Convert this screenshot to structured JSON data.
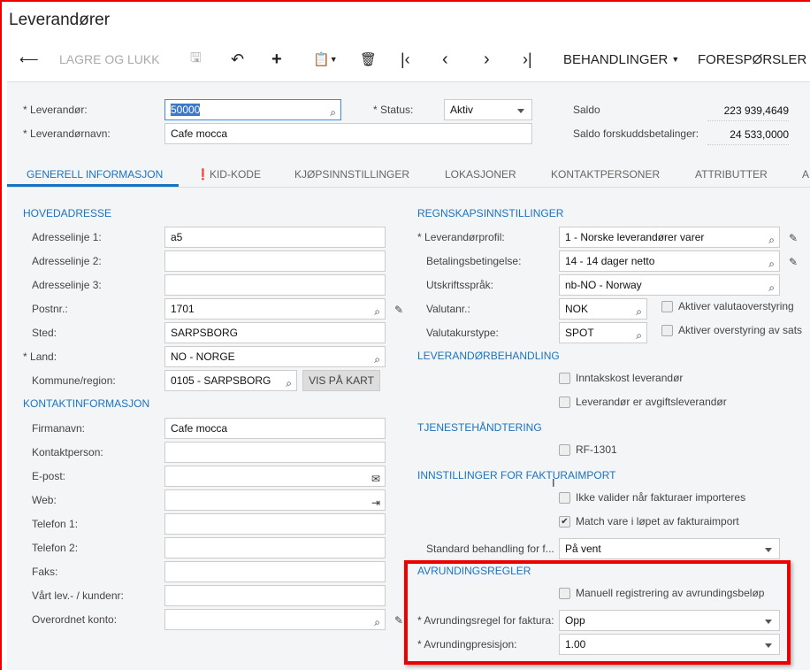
{
  "title": "Leverandører",
  "toolbar": {
    "save_close": "LAGRE OG LUKK",
    "actions": "BEHANDLINGER",
    "inquiries": "FORESPØRSLER"
  },
  "header": {
    "vendor_label": "Leverandør:",
    "vendor_value": "50000",
    "name_label": "Leverandørnavn:",
    "name_value": "Cafe mocca",
    "status_label": "Status:",
    "status_value": "Aktiv",
    "balance_label": "Saldo",
    "balance_value": "223 939,4649",
    "prepay_label": "Saldo forskuddsbetalinger:",
    "prepay_value": "24 533,0000"
  },
  "tabs": [
    "GENERELL INFORMASJON",
    "KID-KODE",
    "KJØPSINNSTILLINGER",
    "LOKASJONER",
    "KONTAKTPERSONER",
    "ATTRIBUTTER",
    "A"
  ],
  "address": {
    "heading": "HOVEDADRESSE",
    "fields": [
      {
        "label": "Adresselinje 1:",
        "value": "a5"
      },
      {
        "label": "Adresselinje 2:",
        "value": ""
      },
      {
        "label": "Adresselinje 3:",
        "value": ""
      },
      {
        "label": "Postnr.:",
        "value": "1701"
      },
      {
        "label": "Sted:",
        "value": "SARPSBORG"
      },
      {
        "label": "Land:",
        "value": "NO - NORGE"
      },
      {
        "label": "Kommune/region:",
        "value": "0105 - SARPSBORG"
      }
    ],
    "map_button": "VIS PÅ KART"
  },
  "contact": {
    "heading": "KONTAKTINFORMASJON",
    "fields": [
      {
        "label": "Firmanavn:",
        "value": "Cafe mocca"
      },
      {
        "label": "Kontaktperson:",
        "value": ""
      },
      {
        "label": "E-post:",
        "value": ""
      },
      {
        "label": "Web:",
        "value": ""
      },
      {
        "label": "Telefon 1:",
        "value": ""
      },
      {
        "label": "Telefon 2:",
        "value": ""
      },
      {
        "label": "Faks:",
        "value": ""
      },
      {
        "label": "Vårt lev.- / kundenr:",
        "value": ""
      },
      {
        "label": "Overordnet konto:",
        "value": ""
      }
    ]
  },
  "accounting": {
    "heading": "REGNSKAPSINNSTILLINGER",
    "fields": [
      {
        "label": "Leverandørprofil:",
        "value": "1 - Norske leverandører varer"
      },
      {
        "label": "Betalingsbetingelse:",
        "value": "14 - 14 dager netto"
      },
      {
        "label": "Utskriftsspråk:",
        "value": "nb-NO - Norway"
      },
      {
        "label": "Valutanr.:",
        "value": "NOK"
      },
      {
        "label": "Valutakurstype:",
        "value": "SPOT"
      }
    ],
    "currency_override": "Aktiver valutaoverstyring",
    "rate_override": "Aktiver overstyring av sats"
  },
  "vendor_handling": {
    "heading": "LEVERANDØRBEHANDLING",
    "landed_cost": "Inntakskost leverandør",
    "tax_agency": "Leverandør er avgiftsleverandør"
  },
  "service": {
    "heading": "TJENESTEHÅNDTERING",
    "rf": "RF-1301"
  },
  "invoice_import": {
    "heading": "INNSTILLINGER FOR FAKTURAIMPORT",
    "no_validate": "Ikke valider når fakturaer importeres",
    "match_item": "Match vare i løpet av fakturaimport",
    "default_label": "Standard behandling for f...",
    "default_value": "På vent"
  },
  "rounding": {
    "heading": "AVRUNDINGSREGLER",
    "manual": "Manuell registrering av avrundingsbeløp",
    "rule_label": "Avrundingsregel for faktura:",
    "rule_value": "Opp",
    "precision_label": "Avrundingpresisjon:",
    "precision_value": "1.00"
  }
}
